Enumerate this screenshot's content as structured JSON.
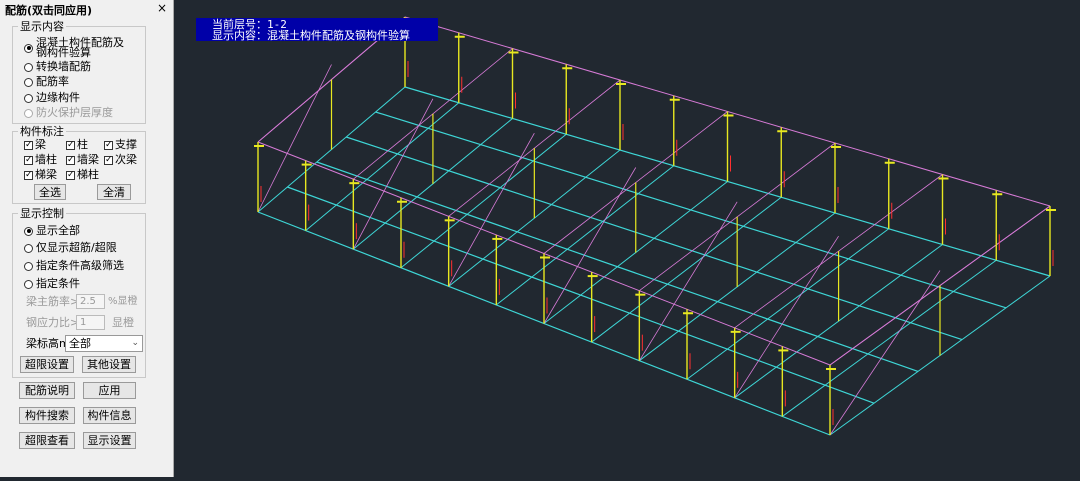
{
  "panel": {
    "title": "配筋(双击同应用)",
    "close": "×",
    "display_content": {
      "label": "显示内容",
      "options": [
        {
          "label": "混凝土构件配筋及钢构件验算",
          "selected": true,
          "disabled": false
        },
        {
          "label": "转换墙配筋",
          "selected": false,
          "disabled": false
        },
        {
          "label": "配筋率",
          "selected": false,
          "disabled": false
        },
        {
          "label": "边缘构件",
          "selected": false,
          "disabled": false
        },
        {
          "label": "防火保护层厚度",
          "selected": false,
          "disabled": true
        }
      ]
    },
    "member_annotation": {
      "label": "构件标注",
      "items": [
        {
          "label": "梁",
          "checked": true
        },
        {
          "label": "柱",
          "checked": true
        },
        {
          "label": "支撑",
          "checked": true
        },
        {
          "label": "墙柱",
          "checked": true
        },
        {
          "label": "墙梁",
          "checked": true
        },
        {
          "label": "次梁",
          "checked": true
        },
        {
          "label": "梯梁",
          "checked": true
        },
        {
          "label": "梯柱",
          "checked": true
        }
      ],
      "select_all": "全选",
      "clear_all": "全清"
    },
    "display_control": {
      "label": "显示控制",
      "options": [
        {
          "label": "显示全部",
          "selected": true
        },
        {
          "label": "仅显示超筋/超限",
          "selected": false
        },
        {
          "label": "指定条件高级筛选",
          "selected": false
        },
        {
          "label": "指定条件",
          "selected": false
        }
      ],
      "beam_ratio": {
        "label": "梁主筋率>",
        "value": "2.5",
        "unit": "%显橙"
      },
      "steel_ratio": {
        "label": "钢应力比>",
        "value": "1",
        "unit": "显橙"
      },
      "beam_elev": {
        "label": "梁标高m",
        "value": "全部"
      },
      "limit_settings": "超限设置",
      "other_settings": "其他设置"
    },
    "buttons": {
      "explain": "配筋说明",
      "apply": "应用",
      "search": "构件搜索",
      "info": "构件信息",
      "overlimit": "超限查看",
      "display_settings": "显示设置"
    }
  },
  "viewport": {
    "floor_line": "当前层号：1-2",
    "content_line": "显示内容：混凝土构件配筋及钢构件验算",
    "colors": {
      "background": "#212830",
      "beam": "#3ed6d6",
      "roof": "#d77bd7",
      "column": "#e8e820",
      "rebar_mark": "#ff3030"
    }
  }
}
